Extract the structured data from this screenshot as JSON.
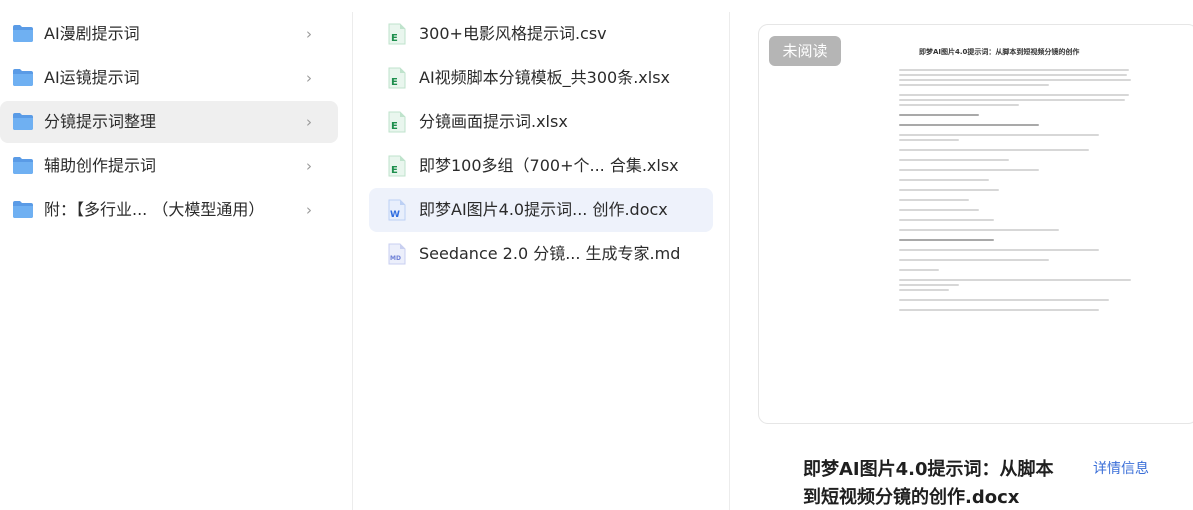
{
  "folders": [
    {
      "label": "AI漫剧提示词",
      "icon": "folder-icon"
    },
    {
      "label": "AI运镜提示词",
      "icon": "folder-icon"
    },
    {
      "label": "分镜提示词整理",
      "icon": "folder-icon",
      "selected": true
    },
    {
      "label": "辅助创作提示词",
      "icon": "folder-icon"
    },
    {
      "label": "附：【多行业...  （大模型通用）",
      "icon": "folder-icon"
    }
  ],
  "chevron": "›",
  "files": [
    {
      "label": "300+电影风格提示词.csv",
      "icon": "excel-file-icon",
      "letter": "E"
    },
    {
      "label": "AI视频脚本分镜模板_共300条.xlsx",
      "icon": "excel-file-icon",
      "letter": "E"
    },
    {
      "label": "分镜画面提示词.xlsx",
      "icon": "excel-file-icon",
      "letter": "E"
    },
    {
      "label": "即梦100多组（700+个...  合集.xlsx",
      "icon": "excel-file-icon",
      "letter": "E"
    },
    {
      "label": "即梦AI图片4.0提示词...  创作.docx",
      "icon": "word-file-icon",
      "letter": "W",
      "selected": true
    },
    {
      "label": "Seedance 2.0 分镜... 生成专家.md",
      "icon": "markdown-file-icon",
      "letter": "MD"
    }
  ],
  "preview": {
    "badge": "未阅读",
    "doc_title": "即梦AI图片4.0提示词：从脚本到短视频分镜的创作",
    "name": "即梦AI图片4.0提示词：从脚本到短视频分镜的创作.docx",
    "details_label": "详情信息"
  },
  "colors": {
    "folder": "#5a9be6",
    "excel": "#1f8f4e",
    "word": "#2f6de0",
    "markdown": "#6d7fd6",
    "selected_folder_bg": "#efefef",
    "selected_file_bg": "#eef2fb",
    "link": "#3b6fd8",
    "badge_bg": "#b5b5b5"
  }
}
